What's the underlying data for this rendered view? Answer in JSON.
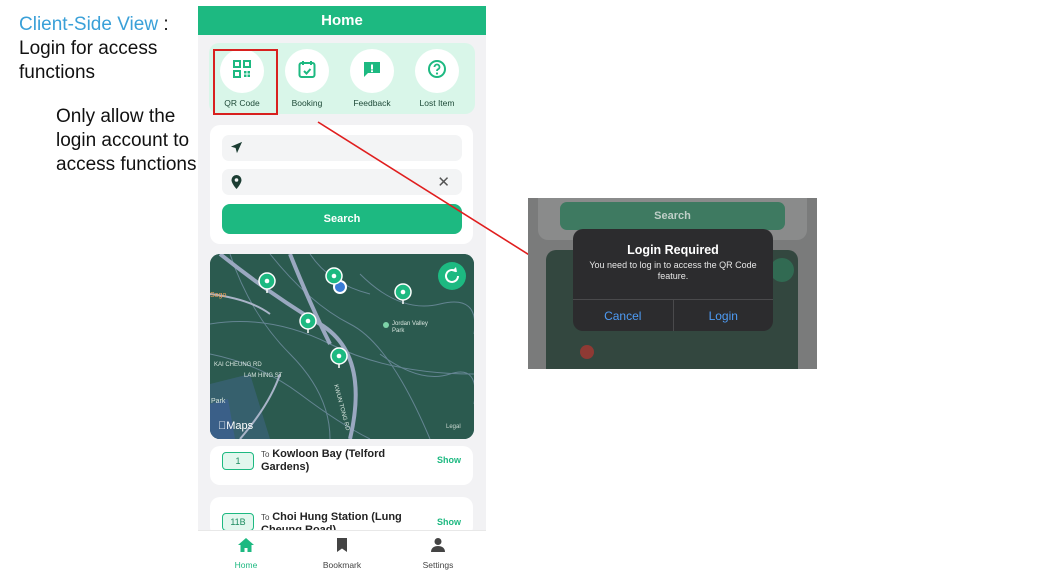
{
  "annotations": {
    "title_highlight": "Client-Side View",
    "title_rest": ":",
    "title_line2": "Login for access functions",
    "note": "Only allow the login account to access functions"
  },
  "app": {
    "header_title": "Home",
    "quick_actions": [
      {
        "label": "QR Code",
        "icon": "qr-code-icon"
      },
      {
        "label": "Booking",
        "icon": "calendar-check-icon"
      },
      {
        "label": "Feedback",
        "icon": "feedback-icon"
      },
      {
        "label": "Lost Item",
        "icon": "help-circle-icon"
      }
    ],
    "search": {
      "origin_icon": "navigation-icon",
      "destination_icon": "map-pin-icon",
      "button_label": "Search"
    },
    "map": {
      "attribution": "Maps",
      "legal": "Legal",
      "place_labels": [
        "Sogo",
        "Jordan Valley Park",
        "KAI CHEUNG RD",
        "LAM HING ST",
        "KWUN TONG RD",
        "Park"
      ]
    },
    "routes": [
      {
        "number": "1",
        "to_prefix": "To",
        "destination": "Kowloon Bay (Telford Gardens)",
        "action": "Show"
      },
      {
        "number": "11B",
        "to_prefix": "To",
        "destination": "Choi Hung Station (Lung Cheung Road)",
        "action": "Show"
      }
    ],
    "tabs": [
      {
        "label": "Home",
        "icon": "home-icon",
        "active": true
      },
      {
        "label": "Bookmark",
        "icon": "bookmark-icon",
        "active": false
      },
      {
        "label": "Settings",
        "icon": "person-icon",
        "active": false
      }
    ]
  },
  "dialog": {
    "background_button": "Search",
    "title": "Login Required",
    "message": "You need to log in to access the QR Code feature.",
    "cancel_label": "Cancel",
    "confirm_label": "Login"
  },
  "colors": {
    "brand_green": "#1db981",
    "highlight_red": "#d8201e",
    "annotation_blue": "#3aa0d8",
    "dialog_button_blue": "#4e9cf5"
  }
}
